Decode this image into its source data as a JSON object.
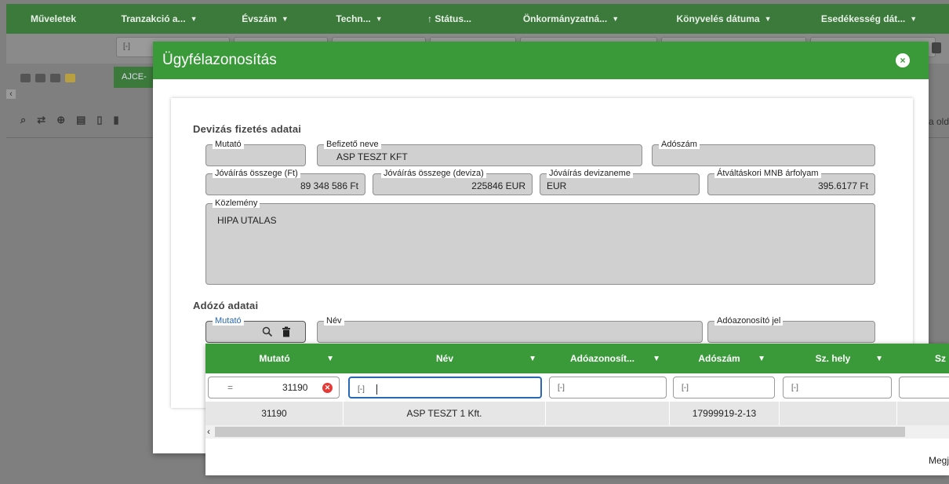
{
  "background": {
    "columns": [
      {
        "label": "Műveletek",
        "arrow": ""
      },
      {
        "label": "Tranzakció a...",
        "arrow": "▼"
      },
      {
        "label": "Évszám",
        "arrow": "▼"
      },
      {
        "label": "Techn...",
        "arrow": "▼"
      },
      {
        "label": "↑ Státus...",
        "arrow": ""
      },
      {
        "label": "Önkormányzatná...",
        "arrow": "▼"
      },
      {
        "label": "Könyvelés dátuma",
        "arrow": "▼"
      },
      {
        "label": "Esedékesség dát...",
        "arrow": "▼"
      }
    ],
    "filter_placeholder": "[-]",
    "tab_label": "AJCE-",
    "right_text": "a old"
  },
  "modal": {
    "title": "Ügyfélazonosítás",
    "close_symbol": "×"
  },
  "deviza": {
    "section_title": "Devizás fizetés adatai",
    "mutato_label": "Mutató",
    "mutato_value": "",
    "befizeto_label": "Befizető neve",
    "befizeto_value": "ASP TESZT KFT",
    "adoszam_label": "Adószám",
    "adoszam_value": "",
    "jovairas_ft_label": "Jóváírás összege (Ft)",
    "jovairas_ft_value": "89 348 586 Ft",
    "jovairas_deviza_label": "Jóváírás összege (deviza)",
    "jovairas_deviza_value": "225846 EUR",
    "devizanem_label": "Jóváírás devizaneme",
    "devizanem_value": "EUR",
    "arfolyam_label": "Átváltáskori MNB árfolyam",
    "arfolyam_value": "395.6177 Ft",
    "kozlemeny_label": "Közlemény",
    "kozlemeny_value": "HIPA UTALAS"
  },
  "adozo": {
    "section_title": "Adózó adatai",
    "mutato_label": "Mutató",
    "nev_label": "Név",
    "adoazonosito_label": "Adóazonosító jel"
  },
  "grid": {
    "columns": [
      {
        "label": "Mutató"
      },
      {
        "label": "Név"
      },
      {
        "label": "Adóazonosít..."
      },
      {
        "label": "Adószám"
      },
      {
        "label": "Sz. hely"
      },
      {
        "label": "Sz"
      }
    ],
    "filter": {
      "operator": "=",
      "mutato_value": "31190",
      "placeholder": "[-]"
    },
    "rows": [
      {
        "mutato": "31190",
        "nev": "ASP TESZT 1 Kft.",
        "adoazonosito": "",
        "adoszam": "17999919-2-13",
        "sz_hely": ""
      }
    ],
    "footer_text": "Megj"
  },
  "colors": {
    "header_green": "#3a9a3a",
    "bg_header_green": "#3c7a3c",
    "focus_blue": "#2a68b5",
    "clear_red": "#e53935"
  }
}
